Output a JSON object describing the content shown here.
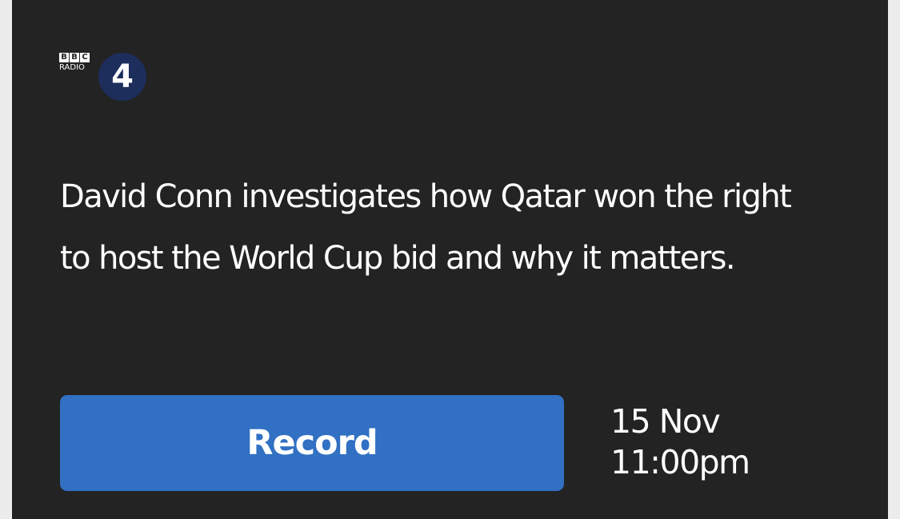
{
  "logo": {
    "bbc_letters": [
      "B",
      "B",
      "C"
    ],
    "radio_label": "RADIO",
    "channel_number": "4",
    "circle_color": "#1d2d5c"
  },
  "description": "David Conn investigates how Qatar won the right to host the World Cup bid and why it matters.",
  "record_button": {
    "label": "Record",
    "color": "#3170c3"
  },
  "schedule": {
    "date": "15 Nov",
    "time": "11:00pm"
  },
  "colors": {
    "card_background": "#232323",
    "page_background": "#ececec",
    "text": "#ffffff"
  }
}
